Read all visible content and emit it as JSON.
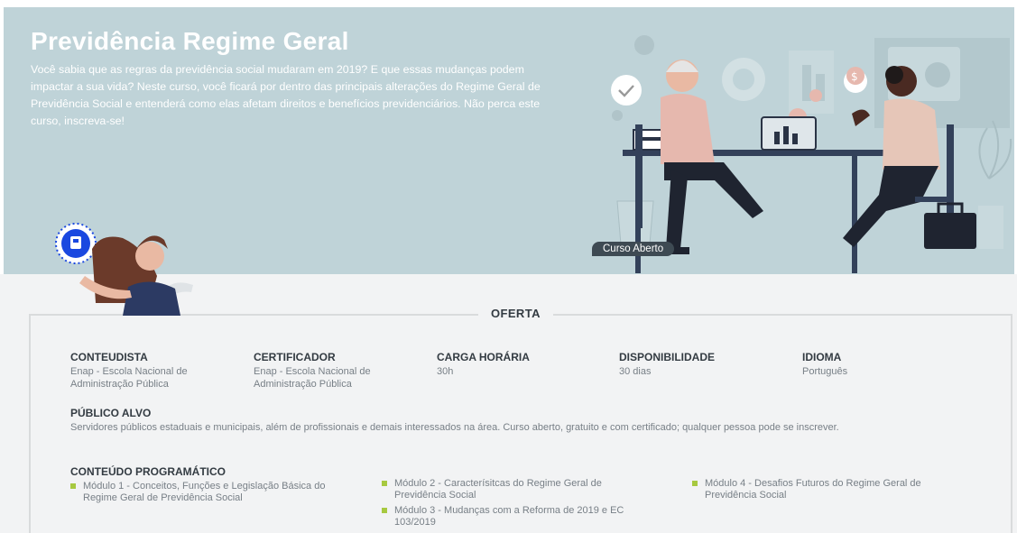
{
  "hero": {
    "title": "Previdência Regime Geral",
    "description": "Você sabia que as regras da previdência social mudaram em 2019? E que essas mudanças podem impactar a sua vida? Neste curso, você ficará por dentro das principais alterações do Regime Geral de Previdência Social e entenderá como elas afetam direitos e benefícios previdenciários. Não perca este curso, inscreva-se!",
    "badge": "Curso Aberto"
  },
  "offer": {
    "title": "OFERTA",
    "info": [
      {
        "label": "CONTEUDISTA",
        "value": "Enap - Escola Nacional de Administração Pública"
      },
      {
        "label": "CERTIFICADOR",
        "value": "Enap - Escola Nacional de Administração Pública"
      },
      {
        "label": "CARGA HORÁRIA",
        "value": "30h"
      },
      {
        "label": "DISPONIBILIDADE",
        "value": "30 dias"
      },
      {
        "label": "IDIOMA",
        "value": "Português"
      }
    ],
    "audience": {
      "label": "PÚBLICO ALVO",
      "text": "Servidores públicos estaduais e municipais, além de profissionais e demais interessados na área. Curso aberto, gratuito e com certificado; qualquer pessoa pode se inscrever."
    },
    "syllabus": {
      "label": "CONTEÚDO PROGRAMÁTICO",
      "modules": [
        "Módulo 1 - Conceitos, Funções e Legislação Básica do Regime Geral de Previdência Social",
        "Módulo 2 - Caracterísitcas do Regime Geral de Previdência Social",
        "Módulo 3 - Mudanças com a Reforma de 2019 e EC 103/2019",
        "Módulo 4 - Desafios Futuros do Regime Geral de Previdência Social"
      ]
    }
  },
  "colors": {
    "hero_bg": "#bfd3d8",
    "lower_bg": "#f2f3f4",
    "bullet": "#a7c940",
    "badge_bg": "#3e4a53",
    "accent_blue": "#1a48e0"
  },
  "icons": {
    "badge_icon": "certificate-icon",
    "illustration": "meeting-illustration",
    "mascot": "presenter-woman-illustration"
  }
}
